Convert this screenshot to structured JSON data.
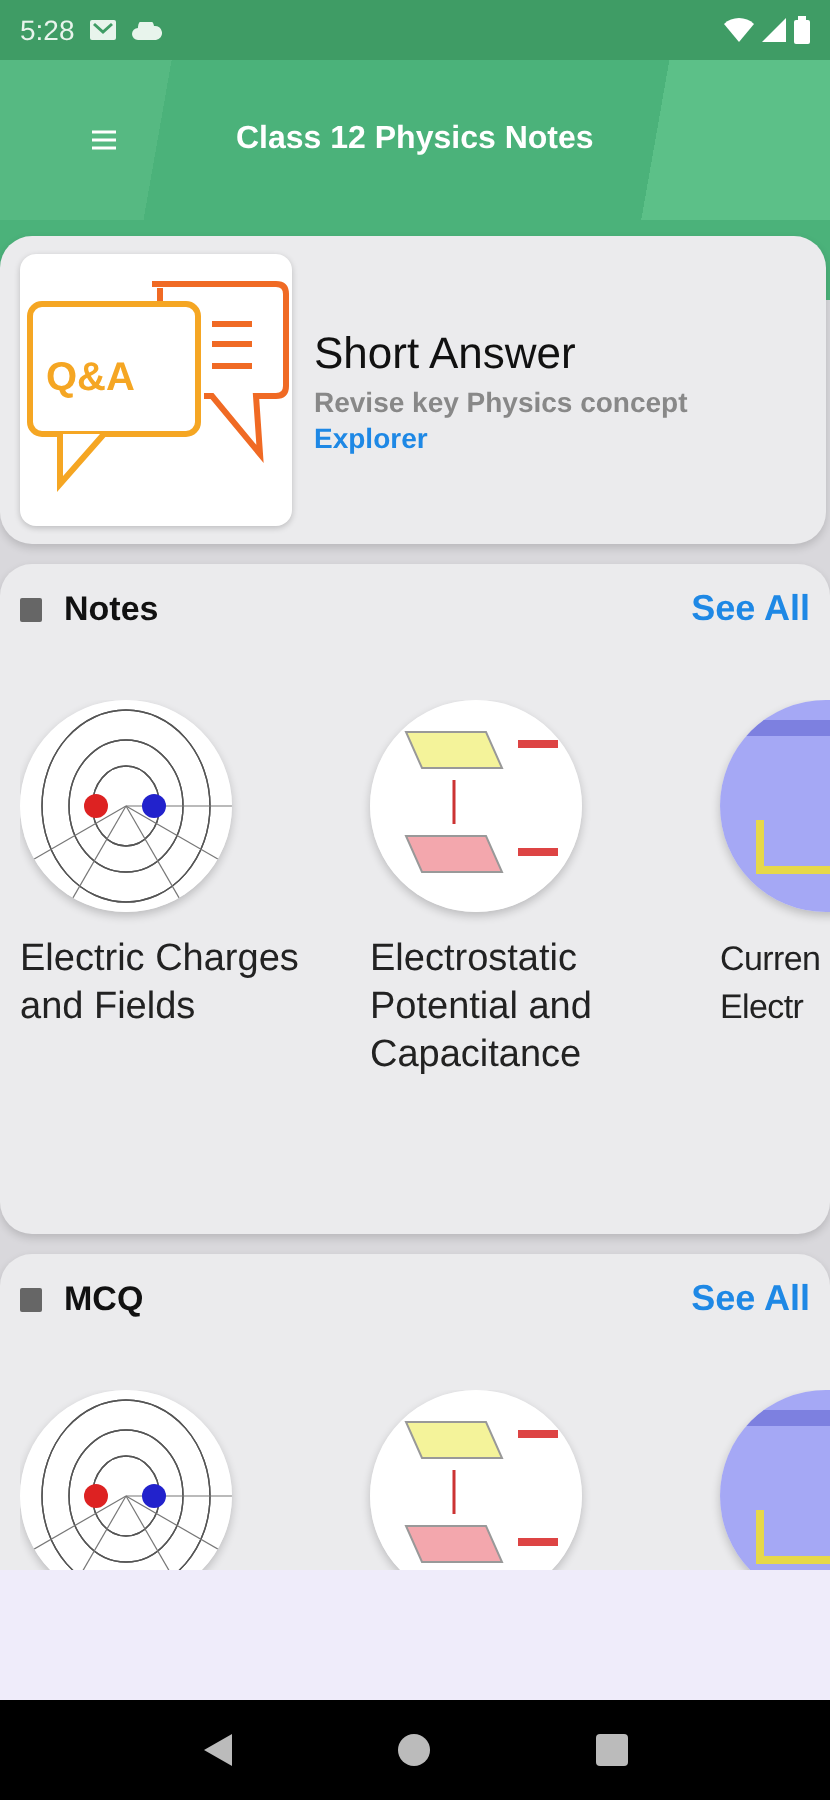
{
  "status_bar": {
    "time": "5:28"
  },
  "app_bar": {
    "title": "Class 12 Physics Notes"
  },
  "feature_card": {
    "icon_text": "Q&A",
    "title": "Short Answer",
    "subtitle": "Revise key Physics concept",
    "link": "Explorer"
  },
  "sections": [
    {
      "title": "Notes",
      "action": "See All",
      "items": [
        {
          "kind": "field",
          "title": "Electric Charges and Fields"
        },
        {
          "kind": "plates",
          "title": "Electrostatic Potential and Capacitance"
        },
        {
          "kind": "circuit",
          "title": "Curren Electr"
        }
      ]
    },
    {
      "title": "MCQ",
      "action": "See All",
      "items": [
        {
          "kind": "field"
        },
        {
          "kind": "plates"
        },
        {
          "kind": "circuit"
        }
      ]
    }
  ]
}
